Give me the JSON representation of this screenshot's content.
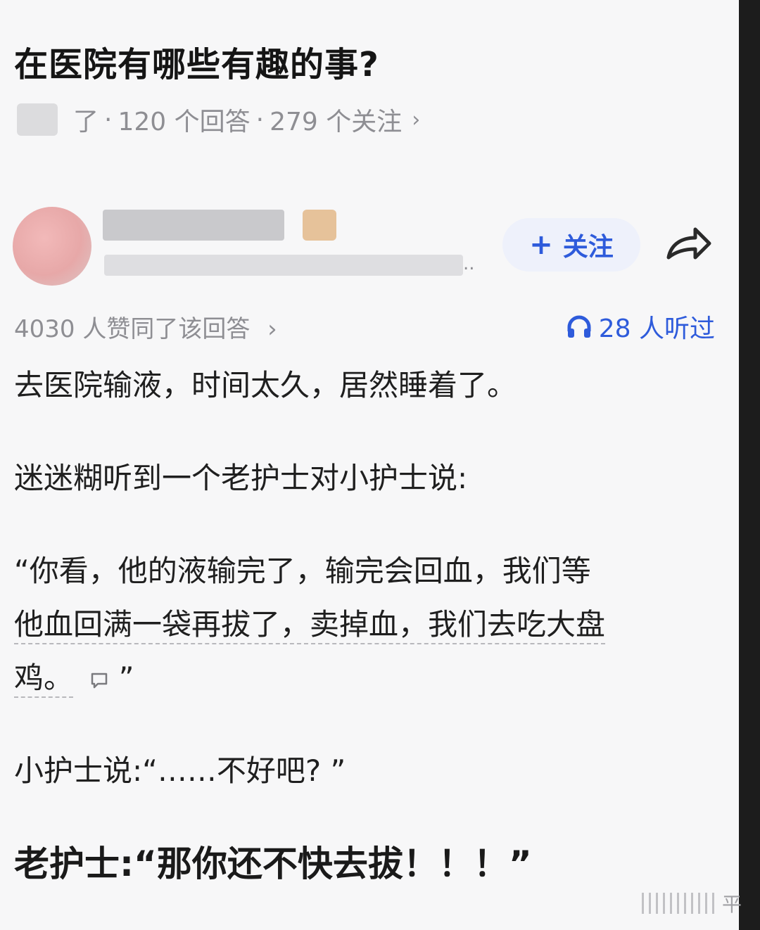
{
  "question": {
    "title": "在医院有哪些有趣的事?",
    "meta": {
      "topic_suffix": "了",
      "answers": "120 个回答",
      "followers": "279 个关注",
      "chevron": "›"
    }
  },
  "author": {
    "follow_plus": "+",
    "follow_label": "关注",
    "bio_ellipsis": ".."
  },
  "answer": {
    "approve_text": "4030 人赞同了该回答",
    "approve_chevron": "›",
    "listen_text": "28 人听过",
    "paragraphs": [
      "去医院输液，时间太久，居然睡着了。",
      "迷迷糊听到一个老护士对小护士说:",
      "“你看，他的液输完了，输完会回血，我们等",
      "他血回满一袋再拔了，卖掉血，我们去吃大盘",
      "鸡。",
      "”",
      "小护士说:“……不好吧? ”",
      "老护士:“那你还不快去拔！！！”"
    ]
  },
  "watermark": {
    "text": "平"
  },
  "colors": {
    "accent": "#2e5bdb",
    "meta_gray": "#8e8e93",
    "background": "#f7f7f8"
  },
  "icons": {
    "share": "share-arrow-icon",
    "listen": "headphones-icon",
    "comment": "comment-bubble-icon"
  }
}
